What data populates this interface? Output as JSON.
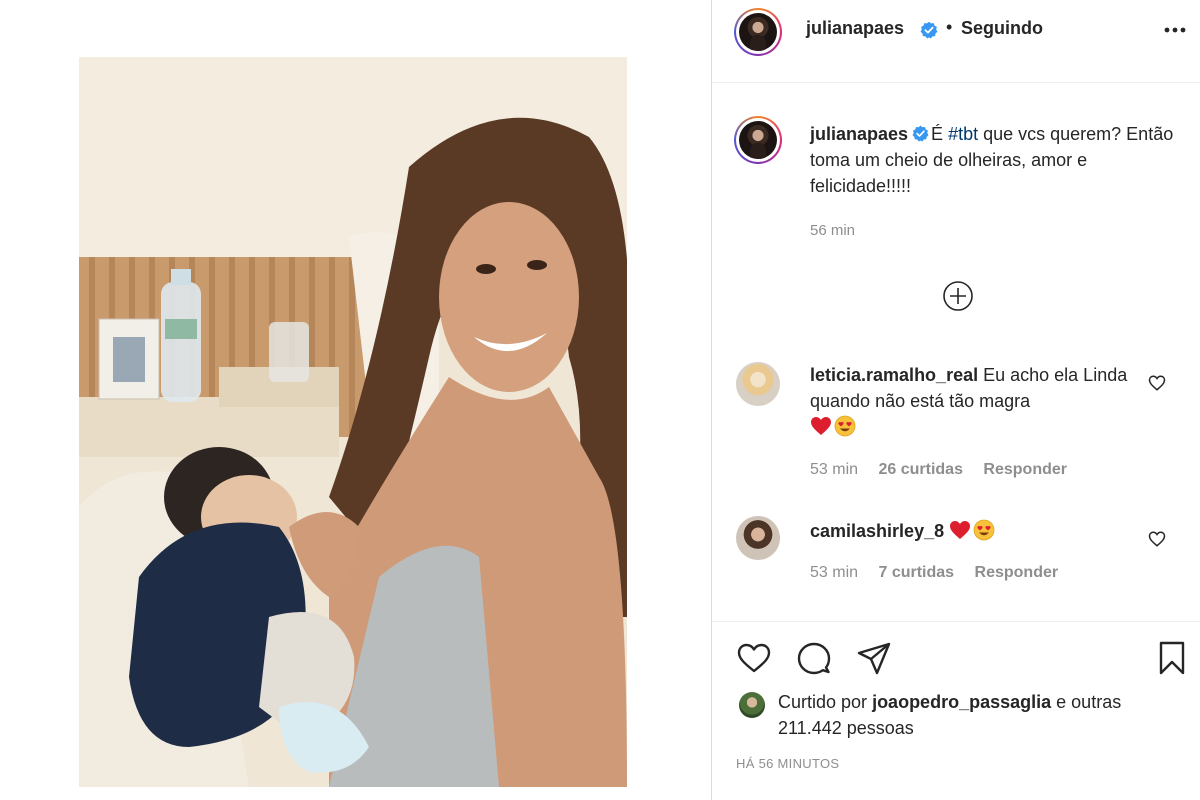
{
  "header": {
    "username": "julianapaes",
    "separator": "•",
    "follow_status": "Seguindo",
    "more_icon": "more-horizontal-icon"
  },
  "caption": {
    "username": "julianapaes",
    "text_before": "É ",
    "hashtag": "#tbt",
    "text_after": " que vcs querem? Então toma um cheio de olheiras, amor e felicidade!!!!!",
    "time": "56 min"
  },
  "load_more_icon": "plus-circle-icon",
  "comments": [
    {
      "username": "leticia.ramalho_real",
      "text": "Eu acho ela Linda quando não está tão magra",
      "emojis": [
        "red-heart",
        "heart-eyes"
      ],
      "time": "53 min",
      "likes": "26 curtidas",
      "reply": "Responder"
    },
    {
      "username": "camilashirley_8",
      "text": "",
      "emojis": [
        "red-heart",
        "heart-eyes"
      ],
      "time": "53 min",
      "likes": "7 curtidas",
      "reply": "Responder"
    }
  ],
  "actions": {
    "like_icon": "heart-outline-icon",
    "comment_icon": "comment-bubble-icon",
    "share_icon": "paper-plane-icon",
    "save_icon": "bookmark-icon"
  },
  "likes_line": {
    "prefix": "Curtido por",
    "user": "joaopedro_passaglia",
    "conjunction": "e",
    "others": "outras 211.442 pessoas"
  },
  "post_time": "HÁ 56 MINUTOS",
  "colors": {
    "verified": "#3897f0",
    "hashtag": "#00376b",
    "secondary_text": "#8e8e8e",
    "emoji_heart": "#dd1e2f"
  }
}
